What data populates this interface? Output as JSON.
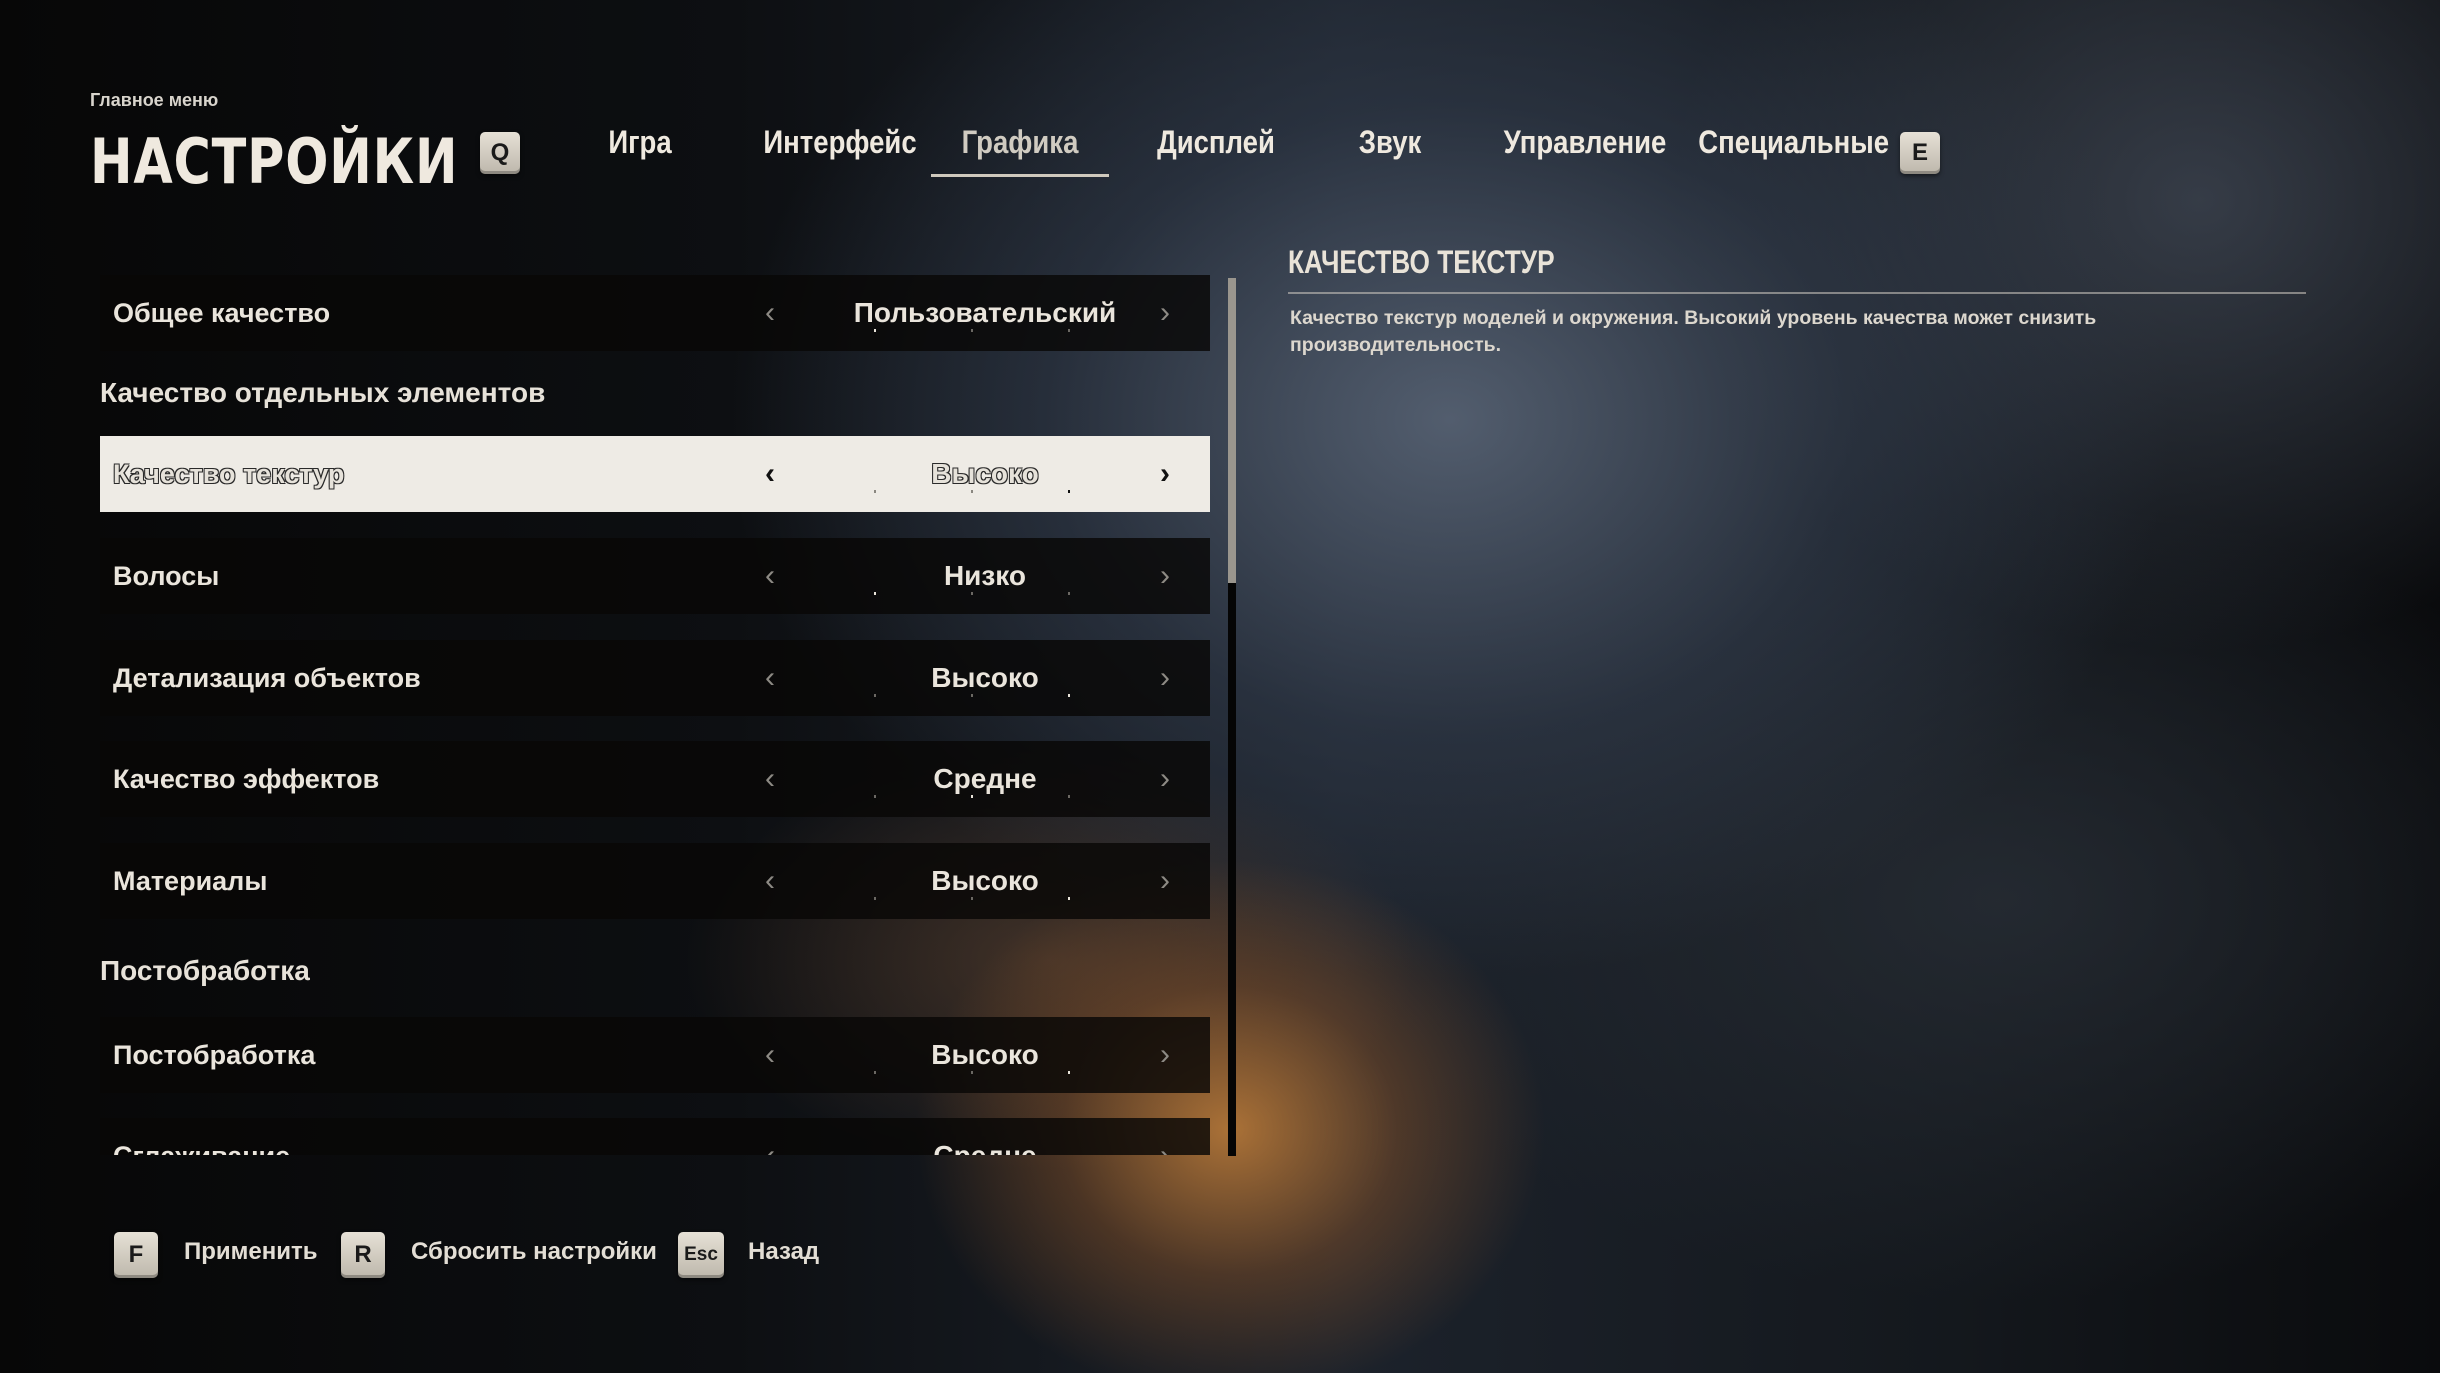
{
  "header": {
    "breadcrumb": "Главное меню",
    "title": "НАСТРОЙКИ",
    "prev_tab_key": "Q",
    "next_tab_key": "E"
  },
  "tabs": [
    {
      "label": "Игра",
      "active": false
    },
    {
      "label": "Интерфейс",
      "active": false
    },
    {
      "label": "Графика",
      "active": true
    },
    {
      "label": "Дисплей",
      "active": false
    },
    {
      "label": "Звук",
      "active": false
    },
    {
      "label": "Управление",
      "active": false
    },
    {
      "label": "Специальные",
      "active": false
    }
  ],
  "sections": {
    "individual": "Качество отдельных элементов",
    "postprocess": "Постобработка"
  },
  "settings": [
    {
      "label": "Общее качество",
      "value": "Пользовательский",
      "level": 0,
      "levels": 3
    },
    {
      "label": "Качество текстур",
      "value": "Высоко",
      "level": 2,
      "levels": 3,
      "selected": true
    },
    {
      "label": "Волосы",
      "value": "Низко",
      "level": 0,
      "levels": 3
    },
    {
      "label": "Детализация объектов",
      "value": "Высоко",
      "level": 2,
      "levels": 3
    },
    {
      "label": "Качество эффектов",
      "value": "Средне",
      "level": 1,
      "levels": 3
    },
    {
      "label": "Материалы",
      "value": "Высоко",
      "level": 2,
      "levels": 3
    },
    {
      "label": "Постобработка",
      "value": "Высоко",
      "level": 2,
      "levels": 3
    },
    {
      "label": "Сглаживание",
      "value": "Средне",
      "level": 1,
      "levels": 3
    }
  ],
  "description": {
    "title": "КАЧЕСТВО ТЕКСТУР",
    "text": "Качество текстур моделей и окружения. Высокий уровень качества может снизить производительность."
  },
  "footer": [
    {
      "key": "F",
      "label": "Применить"
    },
    {
      "key": "R",
      "label": "Сбросить настройки"
    },
    {
      "key": "Esc",
      "label": "Назад"
    }
  ],
  "icons": {
    "arrow_left": "‹",
    "arrow_right": "›"
  }
}
